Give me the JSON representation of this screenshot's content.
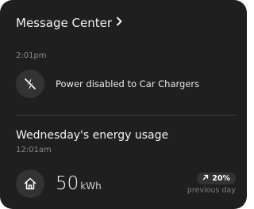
{
  "header": {
    "title": "Message Center",
    "chevron": "chevron-right-icon"
  },
  "message": {
    "time": "2:01pm",
    "icon": "power-off-icon",
    "text": "Power disabled to Car Chargers"
  },
  "energy": {
    "title": "Wednesday's energy usage",
    "time": "12:01am",
    "icon": "home-icon",
    "value": "50",
    "unit": "kWh",
    "change": "20%",
    "change_direction": "up",
    "change_icon": "arrow-up-right-icon",
    "comparison": "previous day"
  },
  "colors": {
    "card_background": "#1f1f1f",
    "icon_background": "#333333",
    "muted_text": "#8a8a8a"
  }
}
